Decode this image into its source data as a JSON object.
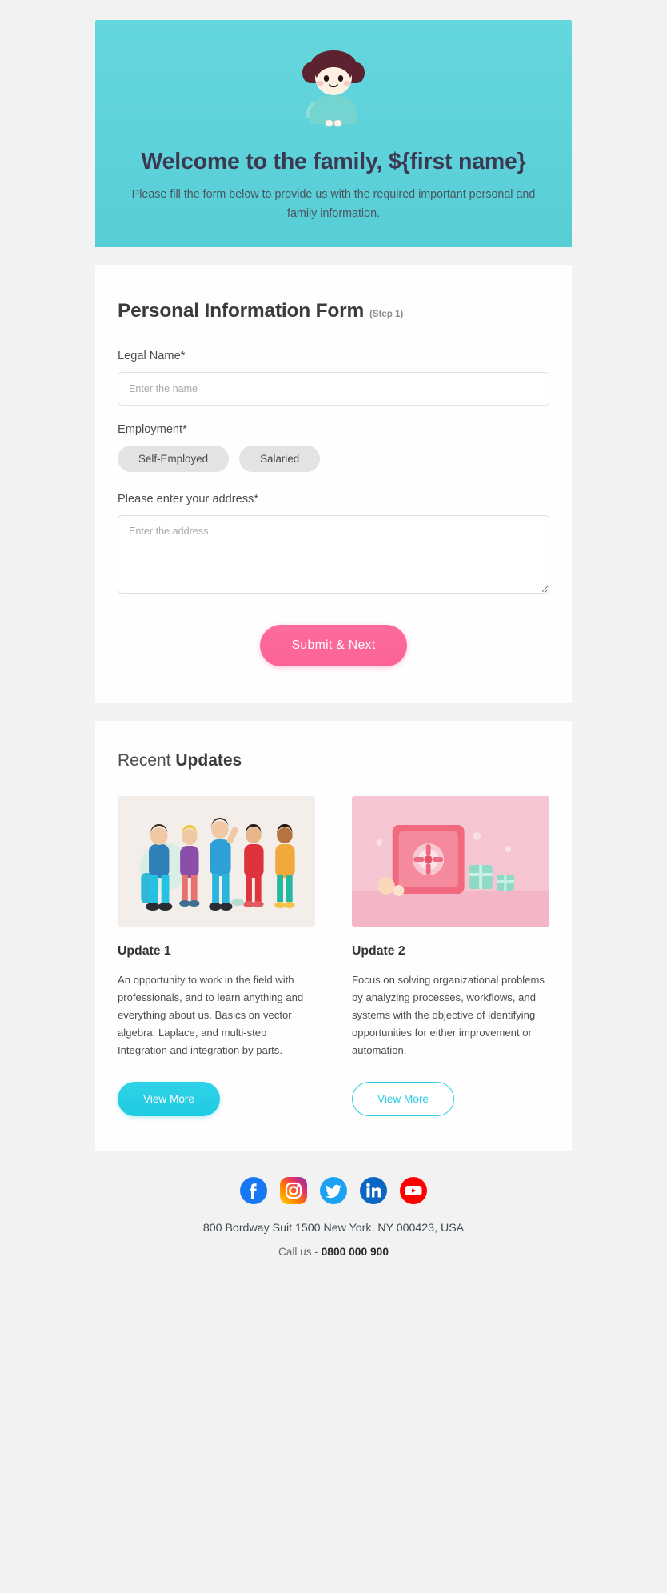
{
  "hero": {
    "mascot_icon": "girl-mascot-illustration",
    "title": "Welcome to the family, ${first name}",
    "subtitle": "Please fill the form below to provide us with the required important personal and family information.",
    "bg_color": "#5ED2DA"
  },
  "form": {
    "title": "Personal Information Form",
    "step": "(Step 1)",
    "legal_name": {
      "label": "Legal Name*",
      "placeholder": "Enter the name",
      "value": ""
    },
    "employment": {
      "label": "Employment*",
      "options": [
        {
          "label": "Self-Employed"
        },
        {
          "label": "Salaried"
        }
      ]
    },
    "address": {
      "label": "Please enter your address*",
      "placeholder": "Enter the address",
      "value": ""
    },
    "submit_label": "Submit & Next",
    "submit_color": "#FC6398"
  },
  "updates": {
    "heading_normal": "Recent ",
    "heading_bold": "Updates",
    "items": [
      {
        "image_icon": "team-people-illustration",
        "title": "Update 1",
        "body": "An opportunity to work in the field with professionals, and to learn anything and everything about us. Basics on vector algebra, Laplace, and multi-step Integration and integration by parts.",
        "button_label": "View More",
        "button_style": "filled"
      },
      {
        "image_icon": "pink-safe-illustration",
        "title": "Update 2",
        "body": "Focus on solving organizational problems by analyzing processes, workflows, and systems with the objective of identifying opportunities for either improvement or automation.",
        "button_label": "View More",
        "button_style": "outline"
      }
    ],
    "accent_color": "#2ACEE4"
  },
  "footer": {
    "socials": [
      {
        "name": "facebook-icon",
        "color": "#1877F2"
      },
      {
        "name": "instagram-icon",
        "color": "#E1306C"
      },
      {
        "name": "twitter-icon",
        "color": "#1DA1F2"
      },
      {
        "name": "linkedin-icon",
        "color": "#0A66C2"
      },
      {
        "name": "youtube-icon",
        "color": "#FF0000"
      }
    ],
    "address": "800 Bordway Suit 1500 New York, NY 000423, USA",
    "call_prefix": "Call us - ",
    "phone": "0800 000 900"
  }
}
